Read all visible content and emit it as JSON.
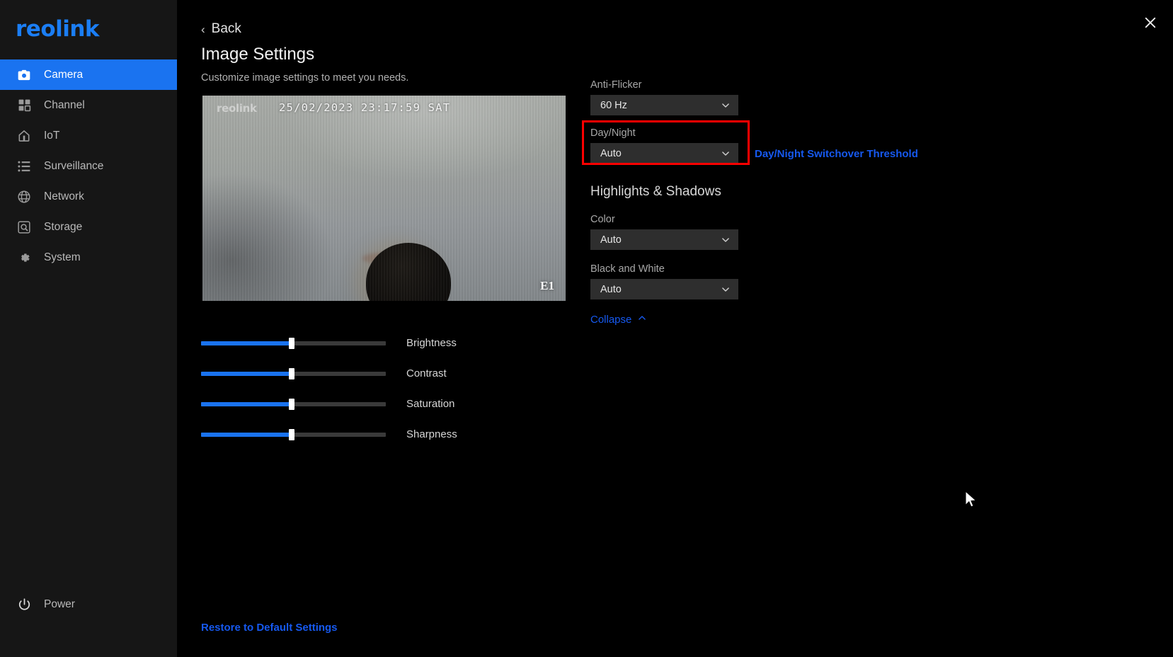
{
  "brand": {
    "name": "reolink"
  },
  "sidebar": {
    "items": [
      {
        "label": "Camera",
        "icon": "camera-icon",
        "active": true
      },
      {
        "label": "Channel",
        "icon": "grid-icon",
        "active": false
      },
      {
        "label": "IoT",
        "icon": "home-icon",
        "active": false
      },
      {
        "label": "Surveillance",
        "icon": "list-icon",
        "active": false
      },
      {
        "label": "Network",
        "icon": "globe-icon",
        "active": false
      },
      {
        "label": "Storage",
        "icon": "hard-drive-icon",
        "active": false
      },
      {
        "label": "System",
        "icon": "gear-icon",
        "active": false
      }
    ],
    "power": {
      "label": "Power",
      "icon": "power-icon"
    }
  },
  "header": {
    "back_label": "Back",
    "title": "Image Settings",
    "subtitle": "Customize image settings to meet you needs.",
    "close_icon": "close-icon"
  },
  "preview": {
    "logo": "reolink",
    "timestamp": "25/02/2023 23:17:59 SAT",
    "model": "E1"
  },
  "sliders": [
    {
      "label": "Brightness",
      "value": 49
    },
    {
      "label": "Contrast",
      "value": 49
    },
    {
      "label": "Saturation",
      "value": 49
    },
    {
      "label": "Sharpness",
      "value": 49
    }
  ],
  "settings": {
    "anti_flicker": {
      "label": "Anti-Flicker",
      "value": "60 Hz"
    },
    "day_night": {
      "label": "Day/Night",
      "value": "Auto",
      "highlighted": true
    },
    "switchover_link": "Day/Night Switchover Threshold",
    "section_title": "Highlights & Shadows",
    "color": {
      "label": "Color",
      "value": "Auto"
    },
    "black_and_white": {
      "label": "Black and White",
      "value": "Auto"
    },
    "collapse_label": "Collapse"
  },
  "footer": {
    "restore_label": "Restore to Default Settings"
  },
  "colors": {
    "accent_blue": "#1a73f0",
    "link_blue": "#1659f0",
    "highlight_red": "#ff0000",
    "sidebar_bg": "#161616",
    "page_bg": "#000000",
    "select_bg": "#2e2e2e"
  }
}
